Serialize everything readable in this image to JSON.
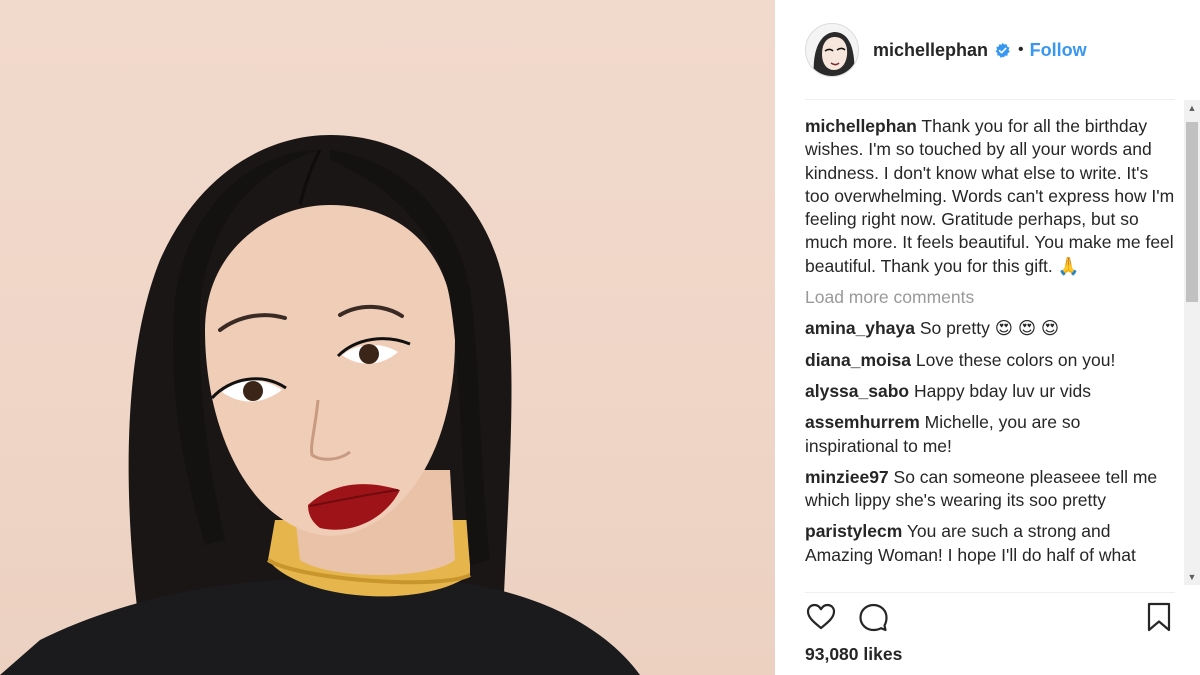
{
  "post": {
    "username": "michellephan",
    "verified_icon": "verified-badge-icon",
    "separator": "•",
    "follow_label": "Follow",
    "caption_user": "michellephan",
    "caption_text": "Thank you for all the birthday wishes. I'm so touched by all your words and kindness. I don't know what else to write. It's too overwhelming. Words can't express how I'm feeling right now. Gratitude perhaps, but so much more. It feels beautiful. You make me feel beautiful. Thank you for this gift. 🙏",
    "load_more": "Load more comments",
    "likes": "93,080 likes"
  },
  "comments": [
    {
      "user": "amina_yhaya",
      "text": "So pretty 😍 😍 😍"
    },
    {
      "user": "diana_moisa",
      "text": "Love these colors on you!"
    },
    {
      "user": "alyssa_sabo",
      "text": "Happy bday luv ur vids"
    },
    {
      "user": "assemhurrem",
      "text": "Michelle, you are so inspirational to me!"
    },
    {
      "user": "minziee97",
      "text": "So can someone pleaseee tell me which lippy she's wearing its soo pretty"
    },
    {
      "user": "paristylecm",
      "text": "You are such a strong and Amazing Woman! I hope I'll do half of what"
    }
  ],
  "icons": {
    "like": "heart-icon",
    "comment": "comment-bubble-icon",
    "save": "bookmark-icon",
    "scroll_up": "▲",
    "scroll_down": "▼"
  },
  "colors": {
    "link_blue": "#3897f0",
    "text": "#262626",
    "muted": "#999999",
    "verified": "#3897f0"
  }
}
